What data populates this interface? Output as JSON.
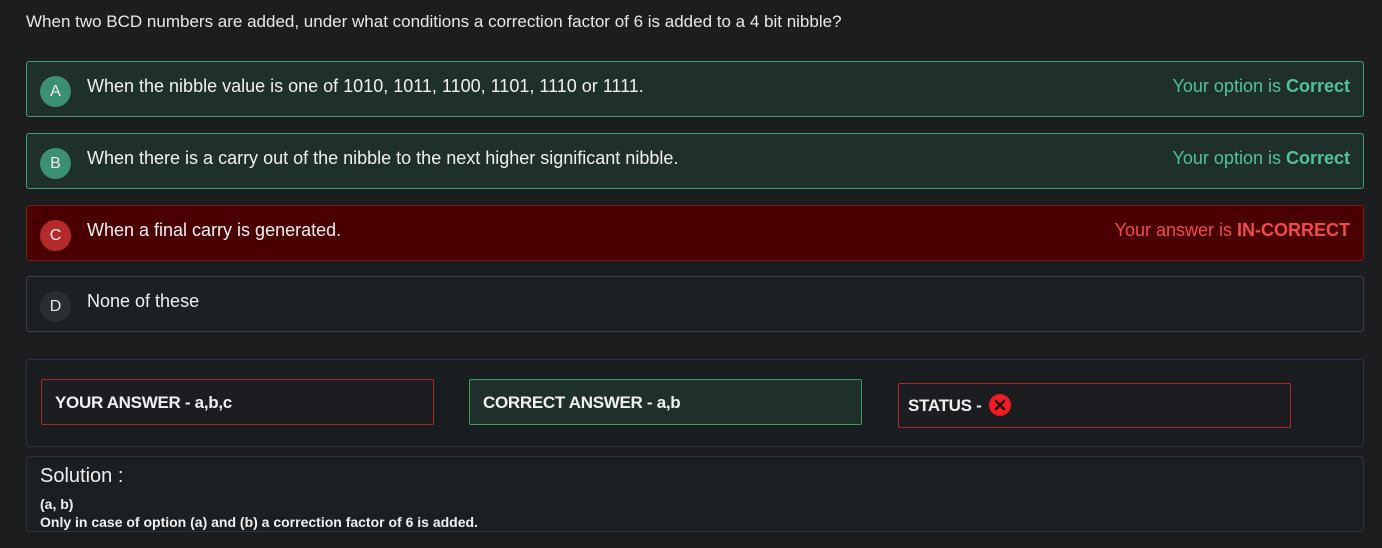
{
  "question": "When two BCD numbers are added, under what conditions a correction factor of 6 is added to a 4 bit nibble?",
  "options": [
    {
      "letter": "A",
      "text": "When the nibble value is one of 1010, 1011, 1100, 1101, 1110 or 1111.",
      "verdict_prefix": "Your option is ",
      "verdict_strong": "Correct",
      "state": "correct"
    },
    {
      "letter": "B",
      "text": "When there is a carry out of the nibble to the next higher significant nibble.",
      "verdict_prefix": "Your option is ",
      "verdict_strong": "Correct",
      "state": "correct"
    },
    {
      "letter": "C",
      "text": "When a final carry is generated.",
      "verdict_prefix": "Your answer is ",
      "verdict_strong": "IN-CORRECT",
      "state": "wrong"
    },
    {
      "letter": "D",
      "text": "None of these",
      "verdict_prefix": "",
      "verdict_strong": "",
      "state": "neutral"
    }
  ],
  "summary": {
    "your_answer": "YOUR ANSWER - a,b,c",
    "correct_answer": "CORRECT ANSWER - a,b",
    "status_label": "STATUS - ",
    "status_icon": "x-circle-icon"
  },
  "solution": {
    "title": "Solution :",
    "answer": "(a, b)",
    "explanation": "Only in case of option (a) and (b) a correction factor of 6 is added."
  },
  "colors": {
    "correct": "#52c29a",
    "wrong": "#ee4b4b",
    "background": "#1b1d1f"
  }
}
